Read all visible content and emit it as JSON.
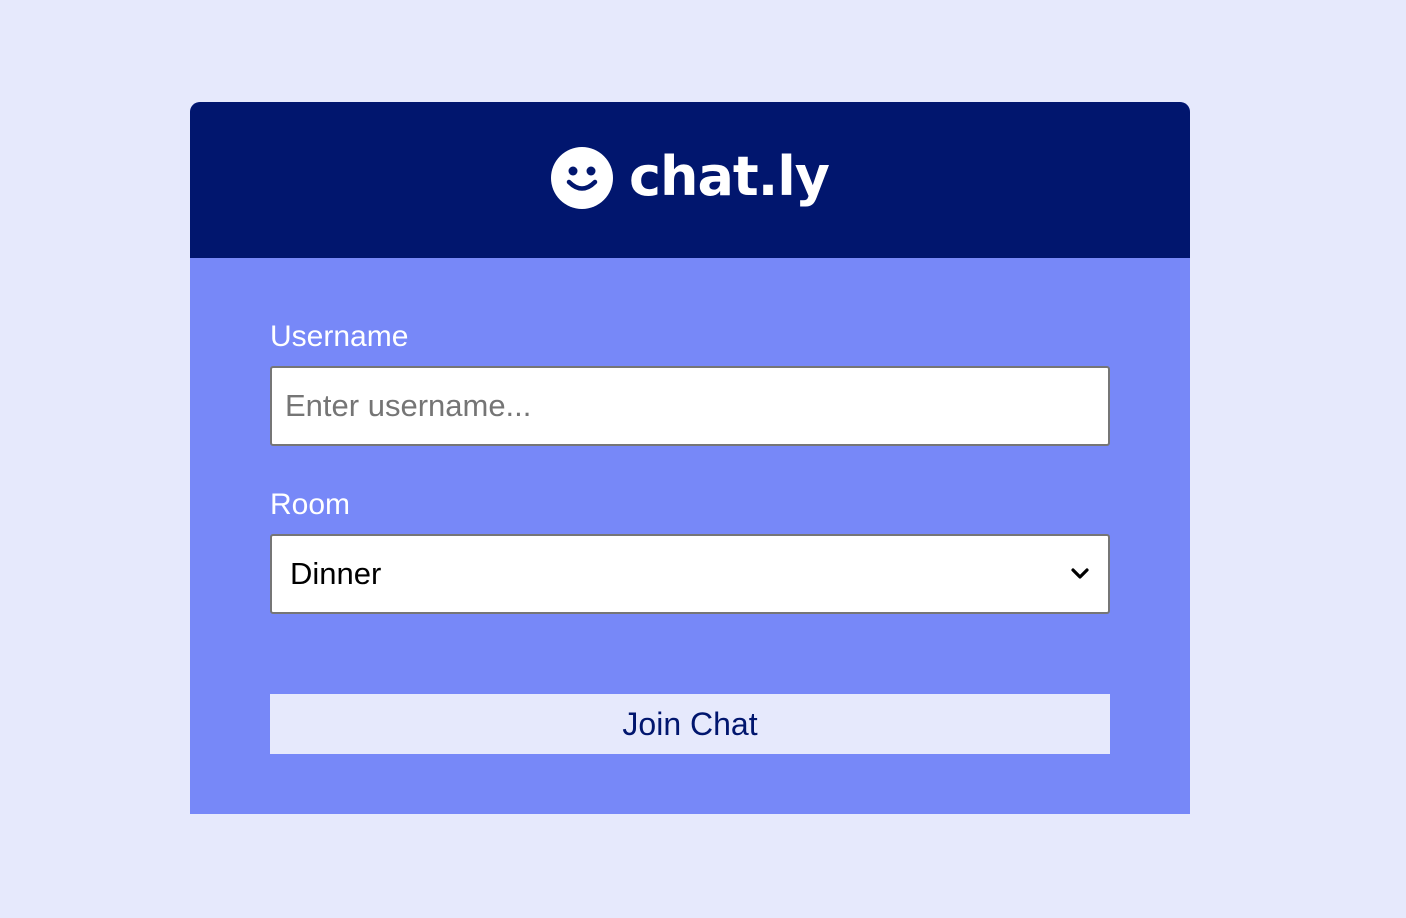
{
  "app": {
    "name": "chat.ly",
    "logo_icon": "smiley-face-icon"
  },
  "form": {
    "username_label": "Username",
    "username_placeholder": "Enter username...",
    "username_value": "",
    "room_label": "Room",
    "room_selected": "Dinner",
    "room_dropdown_icon": "chevron-down-icon",
    "submit_label": "Join Chat"
  },
  "colors": {
    "page_background": "#e6e9fc",
    "header_background": "#01166e",
    "card_background": "#7788f8",
    "button_background": "#e6e9fc",
    "button_text": "#01166e"
  }
}
